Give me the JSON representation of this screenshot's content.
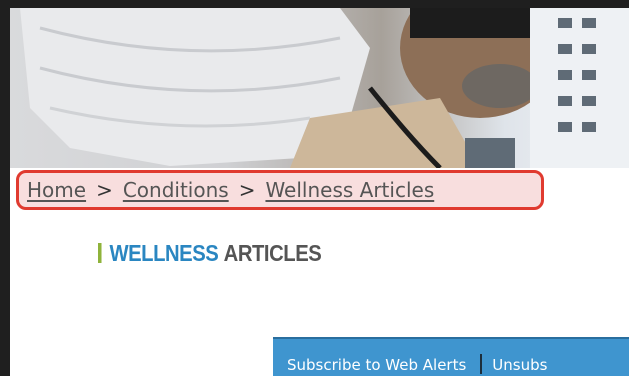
{
  "breadcrumb": {
    "home": "Home",
    "sep": ">",
    "conditions": "Conditions",
    "current": "Wellness Articles"
  },
  "section": {
    "title_part1": "WELLNESS",
    "title_part2": "ARTICLES"
  },
  "alerts": {
    "subscribe": "Subscribe to Web Alerts",
    "unsubscribe": "Unsubs"
  },
  "colors": {
    "highlight_border": "#e03a2f",
    "title_blue": "#2a86c1",
    "title_accent_green": "#8fb33b",
    "alerts_bg": "#3f95cf"
  }
}
